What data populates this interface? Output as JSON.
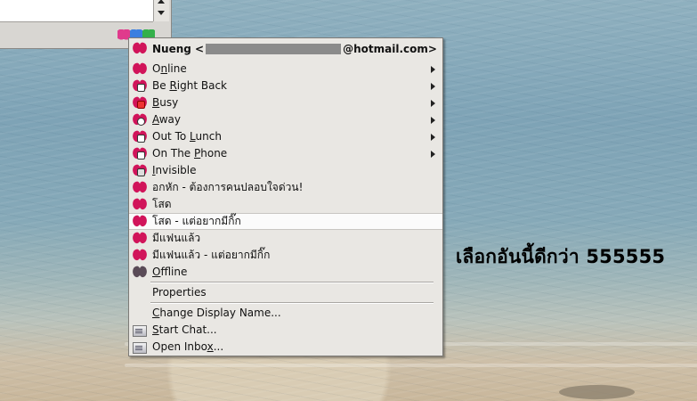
{
  "menu": {
    "header": {
      "name": "Nueng <",
      "email_suffix": "@hotmail.com>"
    },
    "items": [
      {
        "label": "Online",
        "has_submenu": true,
        "icon": "butterfly-online-icon"
      },
      {
        "label": "Be Right Back",
        "has_submenu": true,
        "icon": "butterfly-brb-icon"
      },
      {
        "label": "Busy",
        "has_submenu": true,
        "icon": "butterfly-busy-icon"
      },
      {
        "label": "Away",
        "has_submenu": true,
        "icon": "butterfly-away-icon"
      },
      {
        "label": "Out To Lunch",
        "has_submenu": true,
        "icon": "butterfly-lunch-icon"
      },
      {
        "label": "On The Phone",
        "has_submenu": true,
        "icon": "butterfly-phone-icon"
      },
      {
        "label": "Invisible",
        "has_submenu": false,
        "icon": "butterfly-invisible-icon"
      },
      {
        "label": "อกหัก - ต้องการคนปลอบใจด่วน!",
        "has_submenu": false,
        "icon": "butterfly-icon"
      },
      {
        "label": "โสด",
        "has_submenu": false,
        "icon": "butterfly-icon"
      },
      {
        "label": "โสด - แต่อยากมีกิ๊ก",
        "has_submenu": false,
        "icon": "butterfly-icon",
        "selected": true
      },
      {
        "label": "มีแฟนแล้ว",
        "has_submenu": false,
        "icon": "butterfly-icon"
      },
      {
        "label": "มีแฟนแล้ว - แต่อยากมีกิ๊ก",
        "has_submenu": false,
        "icon": "butterfly-icon"
      },
      {
        "label": "Offline",
        "has_submenu": false,
        "icon": "butterfly-offline-icon"
      }
    ],
    "properties": "Properties",
    "change_display_name": "Change Display Name...",
    "start_chat": "Start Chat...",
    "open_inbox": "Open Inbox..."
  },
  "caption": "เลือกอันนี้ดีกว่า 555555",
  "colors": {
    "butterfly": "#d1145a",
    "menu_bg": "#e9e7e3",
    "selected_bg": "#fbfbfb"
  }
}
